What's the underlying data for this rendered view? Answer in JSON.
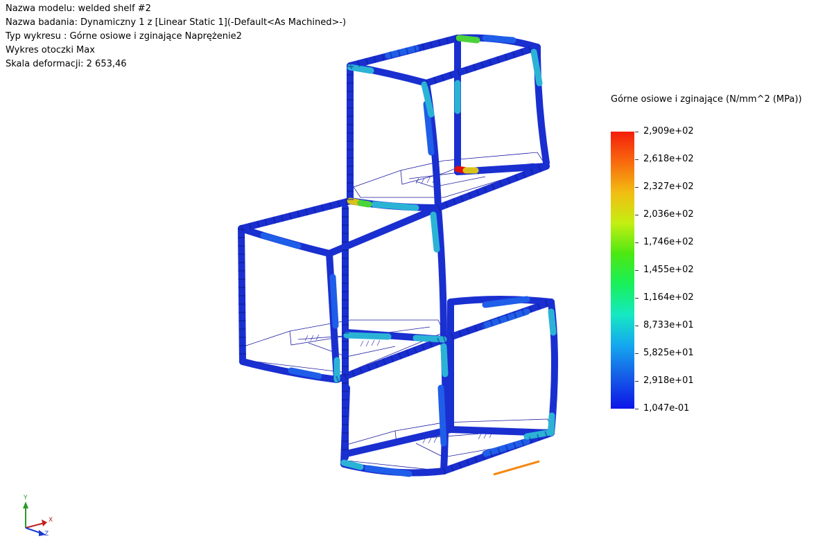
{
  "info": {
    "model_name": "Nazwa modelu: welded shelf #2",
    "study_name": "Nazwa badania: Dynamiczny 1 z [Linear Static 1](-Default<As Machined>-)",
    "plot_type": "Typ wykresu : Górne osiowe i zginające Naprężenie2",
    "envelope": "Wykres otoczki Max",
    "deformation_scale": "Skala deformacji: 2 653,46"
  },
  "legend": {
    "title": "Górne osiowe i zginające (N/mm^2 (MPa))",
    "ticks": [
      "2,909e+02",
      "2,618e+02",
      "2,327e+02",
      "2,036e+02",
      "1,746e+02",
      "1,455e+02",
      "1,164e+02",
      "8,733e+01",
      "5,825e+01",
      "2,918e+01",
      "1,047e-01"
    ]
  },
  "triad": {
    "x": "X",
    "y": "Y",
    "z": "Z"
  },
  "colors": {
    "beam_base": "#1a2fd0",
    "beam_light": "#1f5ee8",
    "beam_cyan": "#2bb3d6",
    "hot_red": "#e01010",
    "hot_yellow": "#d9c21a",
    "hot_green": "#4bd33a",
    "wire": "#1a1aa0",
    "scale_bar": "#f5870f"
  }
}
